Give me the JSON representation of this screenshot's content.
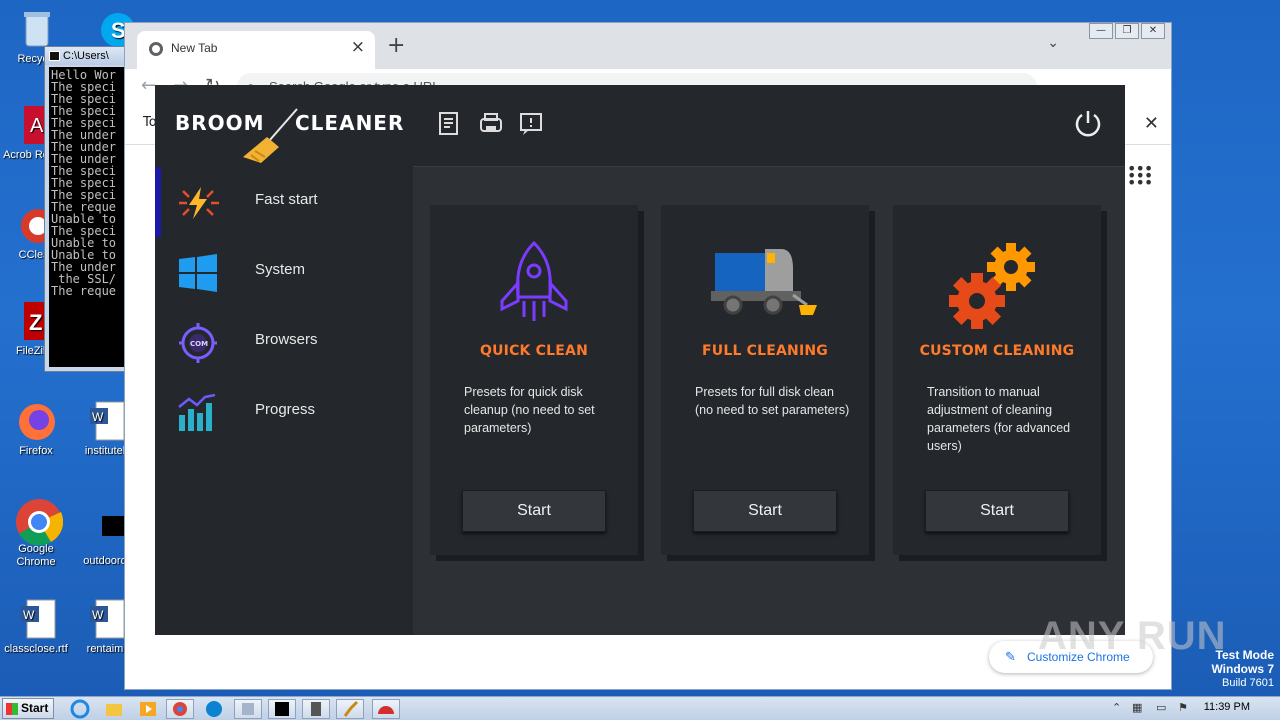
{
  "desktop": {
    "icons": [
      {
        "label": "Recycle",
        "name": "recycle-bin"
      },
      {
        "label": "Acrob Reader",
        "name": "acrobat-reader"
      },
      {
        "label": "CClean",
        "name": "ccleaner"
      },
      {
        "label": "FileZilla",
        "name": "filezilla"
      },
      {
        "label": "Firefox",
        "name": "firefox"
      },
      {
        "label": "institutel",
        "name": "institute-doc"
      },
      {
        "label": "Google Chrome",
        "name": "google-chrome"
      },
      {
        "label": "outdoord",
        "name": "outdoor-file"
      },
      {
        "label": "classclose.rtf",
        "name": "classclose-rtf"
      },
      {
        "label": "rentaim",
        "name": "rentaim-doc"
      }
    ]
  },
  "cmd": {
    "title": "C:\\Users\\",
    "lines": "Hello Wor\nThe speci\nThe speci\nThe speci\nThe speci\nThe under\nThe under\nThe under\nThe speci\nThe speci\nThe speci\nThe reque\nUnable to\nThe speci\nUnable to\nUnable to\nThe under\n the SSL/\nThe reque"
  },
  "chrome": {
    "tab_title": "New Tab",
    "omnibox_placeholder": "Search Google or type a URL",
    "bookmark_text": "To",
    "customize_label": "Customize Chrome"
  },
  "app": {
    "logo_left": "BROOM",
    "logo_right": "CLEANER",
    "nav": [
      {
        "label": "Fast start",
        "icon": "lightning-icon",
        "active": true
      },
      {
        "label": "System",
        "icon": "windows-icon",
        "active": false
      },
      {
        "label": "Browsers",
        "icon": "browser-target-icon",
        "active": false
      },
      {
        "label": "Progress",
        "icon": "chart-icon",
        "active": false
      }
    ],
    "header_icons": [
      "report-icon",
      "printer-icon",
      "feedback-icon"
    ],
    "cards": [
      {
        "title": "QUICK CLEAN",
        "desc": "Presets for quick disk cleanup (no need to set parameters)",
        "button": "Start",
        "icon": "rocket-icon"
      },
      {
        "title": "FULL CLEANING",
        "desc": "Presets for full disk clean (no need to set parameters)",
        "button": "Start",
        "icon": "sweeper-truck-icon"
      },
      {
        "title": "CUSTOM CLEANING",
        "desc": "Transition to manual adjustment of cleaning parameters (for advanced users)",
        "button": "Start",
        "icon": "gears-icon"
      }
    ],
    "colors": {
      "accent": "#ff7a2a",
      "sidebar": "#24272c",
      "panel": "#2d3035",
      "active_bar": "#1a1aa6"
    }
  },
  "overlay": {
    "watermark": "ANY RUN",
    "test_mode": "Test Mode",
    "os": "Windows 7",
    "build": "Build 7601"
  },
  "taskbar": {
    "start": "Start",
    "clock": "11:39 PM"
  }
}
